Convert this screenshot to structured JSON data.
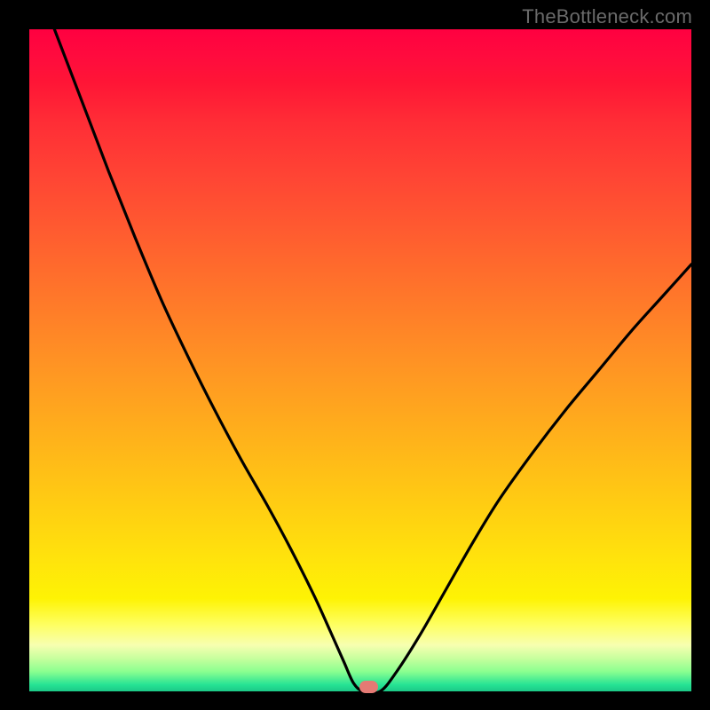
{
  "watermark": "TheBottleneck.com",
  "colors": {
    "background": "#000000",
    "curve_stroke": "#000000",
    "marker_fill": "#e47a74"
  },
  "marker": {
    "x_frac": 0.512,
    "y_frac": 0.996
  },
  "chart_data": {
    "type": "line",
    "title": "",
    "xlabel": "",
    "ylabel": "",
    "xlim": [
      0,
      1
    ],
    "ylim": [
      0,
      1
    ],
    "notes": "V-shaped bottleneck curve over a vertical heat gradient (red=high bottleneck at top, green=low at bottom). Minimum near x≈0.51. x and y are normalized to plot extents; the page has no axis tick labels.",
    "series": [
      {
        "name": "bottleneck-curve",
        "x": [
          0.038,
          0.08,
          0.12,
          0.16,
          0.2,
          0.24,
          0.28,
          0.32,
          0.36,
          0.395,
          0.43,
          0.455,
          0.475,
          0.49,
          0.505,
          0.53,
          0.555,
          0.59,
          0.63,
          0.67,
          0.71,
          0.76,
          0.81,
          0.86,
          0.91,
          0.955,
          1.0
        ],
        "y": [
          1.0,
          0.89,
          0.785,
          0.685,
          0.59,
          0.505,
          0.425,
          0.35,
          0.28,
          0.215,
          0.145,
          0.09,
          0.045,
          0.012,
          0.0,
          0.0,
          0.03,
          0.085,
          0.155,
          0.225,
          0.29,
          0.36,
          0.425,
          0.485,
          0.545,
          0.595,
          0.645
        ]
      }
    ]
  }
}
